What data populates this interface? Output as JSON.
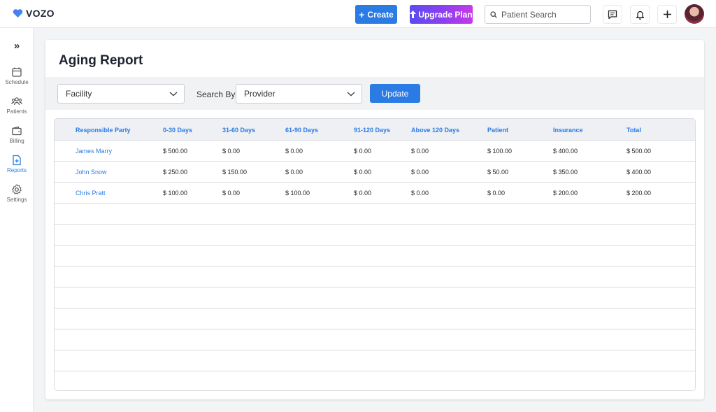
{
  "brand": {
    "name": "VOZO",
    "accent": "#2b7be4"
  },
  "topbar": {
    "create_label": "Create",
    "upgrade_label": "Upgrade Plan",
    "search_placeholder": "Patient Search",
    "icons": [
      "chat-icon",
      "bell-icon",
      "plus-icon"
    ]
  },
  "sidebar": {
    "items": [
      {
        "label": "Schedule",
        "icon": "calendar-icon"
      },
      {
        "label": "Patients",
        "icon": "users-icon"
      },
      {
        "label": "Billing",
        "icon": "wallet-icon"
      },
      {
        "label": "Reports",
        "icon": "report-icon",
        "active": true
      },
      {
        "label": "Settings",
        "icon": "gear-icon"
      }
    ]
  },
  "page": {
    "title": "Aging Report"
  },
  "filters": {
    "facility_value": "Facility",
    "search_by_label": "Search By",
    "provider_value": "Provider",
    "update_label": "Update"
  },
  "table": {
    "headers": [
      "Responsible Party",
      "0-30 Days",
      "31-60 Days",
      "61-90 Days",
      "91-120 Days",
      "Above 120 Days",
      "Patient",
      "Insurance",
      "Total"
    ],
    "rows": [
      [
        "James Marry",
        "$ 500.00",
        "$ 0.00",
        "$ 0.00",
        "$ 0.00",
        "$ 0.00",
        "$ 100.00",
        "$ 400.00",
        "$ 500.00"
      ],
      [
        "John Snow",
        "$ 250.00",
        "$ 150.00",
        "$ 0.00",
        "$ 0.00",
        "$ 0.00",
        "$ 50.00",
        "$ 350.00",
        "$ 400.00"
      ],
      [
        "Chris Pratt",
        "$ 100.00",
        "$ 0.00",
        "$ 100.00",
        "$ 0.00",
        "$ 0.00",
        "$ 0.00",
        "$ 200.00",
        "$ 200.00"
      ]
    ]
  }
}
